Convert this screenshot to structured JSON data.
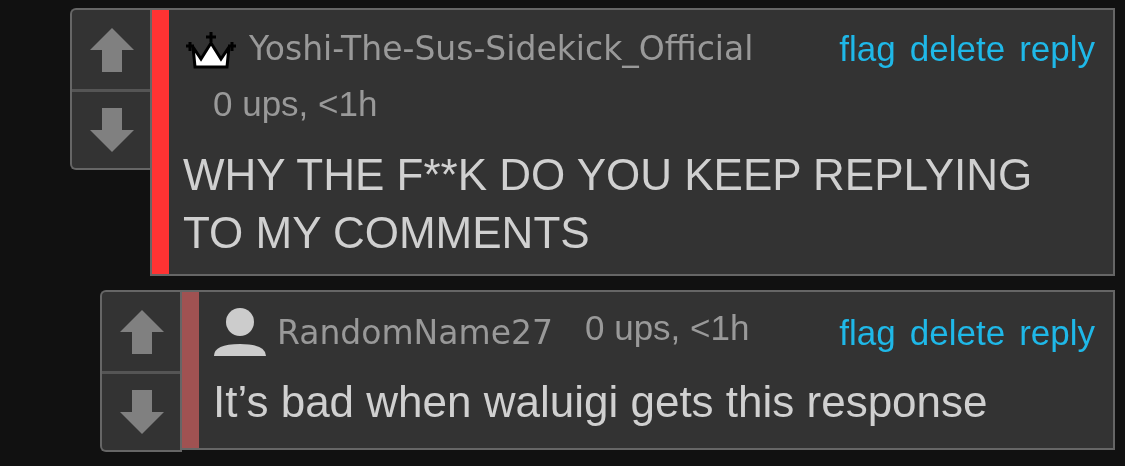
{
  "comments": [
    {
      "kind": "crown",
      "color": "#ff3333",
      "username": "Yoshi-The-Sus-Sidekick_Official",
      "meta": "0 ups, <1h",
      "actions": [
        "flag",
        "delete",
        "reply"
      ],
      "body": "WHY THE F**K DO YOU KEEP REPLYING TO MY COMMENTS"
    },
    {
      "kind": "person",
      "color": "#a05252",
      "username": "RandomName27",
      "meta": "0 ups, <1h",
      "actions": [
        "flag",
        "delete",
        "reply"
      ],
      "body": "It’s bad when waluigi gets this response"
    }
  ]
}
